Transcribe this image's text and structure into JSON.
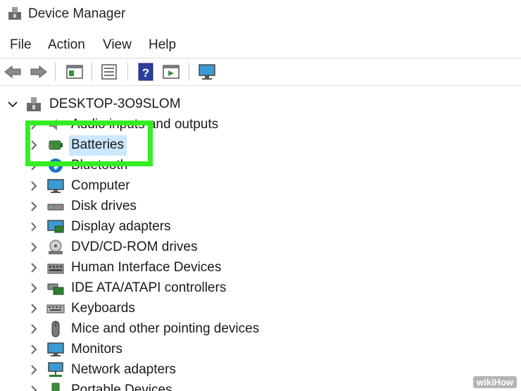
{
  "window": {
    "title": "Device Manager"
  },
  "menu": {
    "file": "File",
    "action": "Action",
    "view": "View",
    "help": "Help"
  },
  "toolbar": {
    "buttons": [
      "back-icon",
      "forward-icon",
      "console-tree-icon",
      "properties-icon",
      "help-icon",
      "action-pane-icon",
      "scan-hardware-icon"
    ]
  },
  "tree": {
    "root": "DESKTOP-3O9SLOM",
    "items": [
      {
        "label": "Audio inputs and outputs"
      },
      {
        "label": "Batteries",
        "selected": true
      },
      {
        "label": "Bluetooth"
      },
      {
        "label": "Computer"
      },
      {
        "label": "Disk drives"
      },
      {
        "label": "Display adapters"
      },
      {
        "label": "DVD/CD-ROM drives"
      },
      {
        "label": "Human Interface Devices"
      },
      {
        "label": "IDE ATA/ATAPI controllers"
      },
      {
        "label": "Keyboards"
      },
      {
        "label": "Mice and other pointing devices"
      },
      {
        "label": "Monitors"
      },
      {
        "label": "Network adapters"
      },
      {
        "label": "Portable Devices"
      }
    ]
  },
  "highlight_color": "#33ee22",
  "selection_color": "#cce8ff",
  "watermark": "wikiHow"
}
